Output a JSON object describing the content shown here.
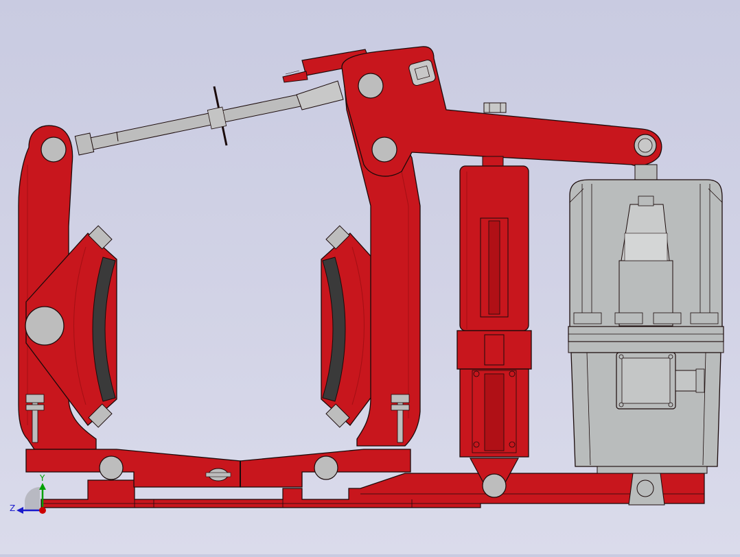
{
  "colors": {
    "background_top": "#c9cbe1",
    "background_bottom": "#dadbeb",
    "frame_red": "#c8161d",
    "frame_red_shadow": "#a40f14",
    "outline": "#1a0a0a",
    "pin_gray": "#bdbdbd",
    "steel": "#b8b8b8",
    "motor_gray": "#b9bcbc",
    "motor_light": "#d4d6d6",
    "lining_dark": "#3a3a3a",
    "axis_x": "#cc0000",
    "axis_y": "#00a000",
    "axis_z": "#1a1acc"
  },
  "axes": {
    "y_label": "Y",
    "z_label": "Z"
  },
  "icons": {
    "triad": "coordinate-triad-icon"
  }
}
